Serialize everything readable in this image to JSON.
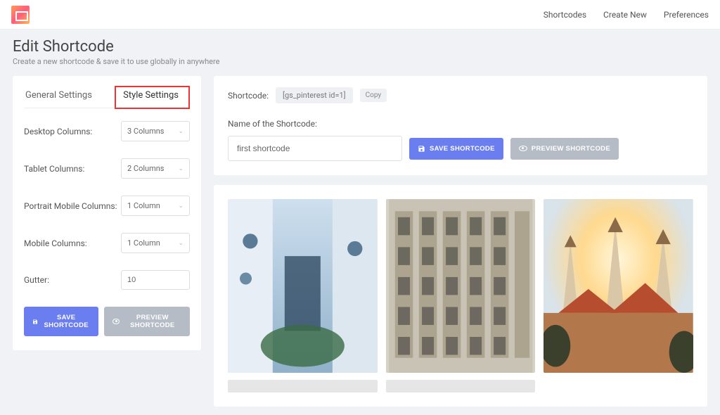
{
  "topnav": {
    "shortcodes": "Shortcodes",
    "create": "Create New",
    "prefs": "Preferences"
  },
  "page": {
    "title": "Edit Shortcode",
    "subtitle": "Create a new shortcode & save it to use globally in anywhere"
  },
  "tabs": {
    "general": "General Settings",
    "style": "Style Settings"
  },
  "fields": {
    "desktop": {
      "label": "Desktop Columns:",
      "value": "3 Columns"
    },
    "tablet": {
      "label": "Tablet Columns:",
      "value": "2 Columns"
    },
    "portrait": {
      "label": "Portrait Mobile Columns:",
      "value": "1 Column"
    },
    "mobile": {
      "label": "Mobile Columns:",
      "value": "1 Column"
    },
    "gutter": {
      "label": "Gutter:",
      "value": "10"
    }
  },
  "buttons": {
    "save": "SAVE SHORTCODE",
    "preview": "PREVIEW SHORTCODE"
  },
  "shortcode": {
    "label": "Shortcode:",
    "value": "[gs_pinterest id=1]",
    "copy": "Copy"
  },
  "name": {
    "label": "Name of the Shortcode:",
    "value": "first shortcode"
  }
}
